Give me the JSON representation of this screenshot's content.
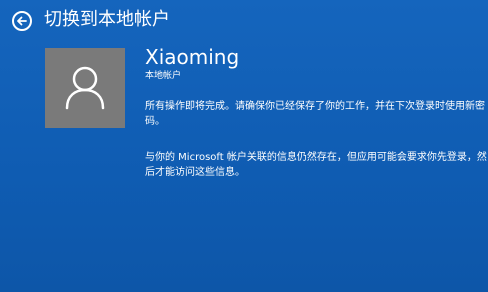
{
  "header": {
    "back_icon": "back-arrow-circle-icon",
    "title": "切换到本地帐户"
  },
  "account": {
    "avatar_icon": "user-silhouette-icon",
    "name": "Xiaoming",
    "type": "本地帐户"
  },
  "messages": {
    "line1": "所有操作即将完成。请确保你已经保存了你的工作，并在下次登录时使用新密码。",
    "line2": "与你的 Microsoft 帐户关联的信息仍然存在，但应用可能会要求你先登录，然后才能访问这些信息。"
  },
  "colors": {
    "background": "#0f5fb5",
    "avatar_background": "#7a7a7a",
    "text": "#ffffff"
  }
}
